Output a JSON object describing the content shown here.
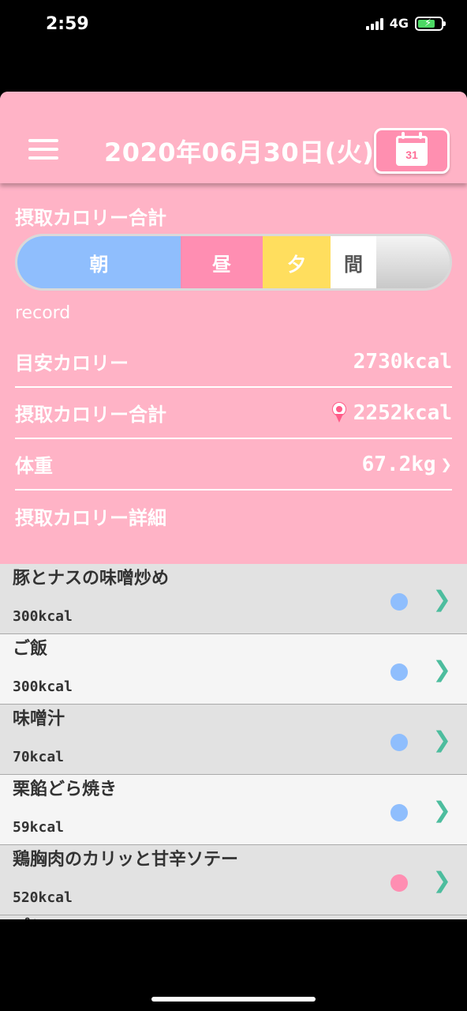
{
  "status": {
    "time": "2:59",
    "network": "4G"
  },
  "header": {
    "date": "2020年06月30日(火)",
    "calendar_day": "31"
  },
  "summary": {
    "title": "摂取カロリー合計",
    "segments": {
      "breakfast": "朝",
      "lunch": "昼",
      "dinner": "夕",
      "snack": "間"
    },
    "record_label": "record",
    "rows": [
      {
        "label": "目安カロリー",
        "value": "2730kcal"
      },
      {
        "label": "摂取カロリー合計",
        "value": "2252kcal"
      },
      {
        "label": "体重",
        "value": "67.2kg"
      },
      {
        "label": "摂取カロリー詳細"
      }
    ]
  },
  "items": [
    {
      "name": "豚とナスの味噌炒め",
      "kcal": "300kcal",
      "dot_color": "#8fbefd"
    },
    {
      "name": "ご飯",
      "kcal": "300kcal",
      "dot_color": "#8fbefd"
    },
    {
      "name": "味噌汁",
      "kcal": "70kcal",
      "dot_color": "#8fbefd"
    },
    {
      "name": "栗餡どら焼き",
      "kcal": "59kcal",
      "dot_color": "#8fbefd"
    },
    {
      "name": "鶏胸肉のカリッと甘辛ソテー",
      "kcal": "520kcal",
      "dot_color": "#ff8eb2"
    },
    {
      "name": "パン"
    }
  ],
  "colors": {
    "header_pink": "#ffb3c6",
    "accent_green": "#4dbd9e"
  }
}
